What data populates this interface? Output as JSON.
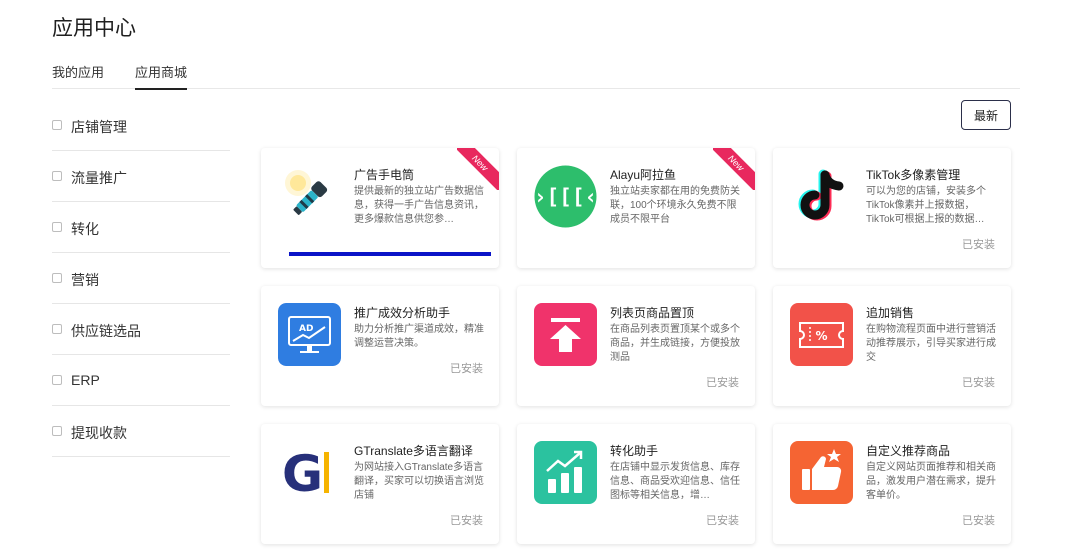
{
  "page": {
    "title": "应用中心"
  },
  "tabs": [
    {
      "label": "我的应用"
    },
    {
      "label": "应用商城"
    }
  ],
  "active_tab": "应用商城",
  "sidebar": {
    "categories": [
      {
        "label": "店铺管理"
      },
      {
        "label": "流量推广"
      },
      {
        "label": "转化"
      },
      {
        "label": "营销"
      },
      {
        "label": "供应链选品"
      },
      {
        "label": "ERP"
      },
      {
        "label": "提现收款"
      }
    ]
  },
  "sort": {
    "label": "最新"
  },
  "apps": [
    {
      "name": "广告手电筒",
      "desc": "提供最新的独立站广告数据信息，获得一手广告信息资讯，更多爆款信息供您参…",
      "status": "",
      "badge": "New",
      "progress": 1.0,
      "icon": "flashlight-icon",
      "icon_color": "#ffffff"
    },
    {
      "name": "Alayu阿拉鱼",
      "desc": "独立站卖家都在用的免费防关联，100个环境永久免费不限成员不限平台",
      "status": "",
      "badge": "New",
      "icon": "alayu-icon",
      "icon_color": "#2dbe6c"
    },
    {
      "name": "TikTok多像素管理",
      "desc": "可以为您的店铺，安装多个TikTok像素并上报数据，TikTok可根据上报的数据…",
      "status": "已安装",
      "icon": "tiktok-icon",
      "icon_color": "#ffffff"
    },
    {
      "name": "推广成效分析助手",
      "desc": "助力分析推广渠道成效，精准调整运营决策。",
      "status": "已安装",
      "icon": "ad-analysis-icon",
      "icon_color": "#2f7de1"
    },
    {
      "name": "列表页商品置顶",
      "desc": "在商品列表页置顶某个或多个商品，并生成链接，方便投放测品",
      "status": "已安装",
      "icon": "pin-top-icon",
      "icon_color": "#f0336b"
    },
    {
      "name": "追加销售",
      "desc": "在购物流程页面中进行营销活动推荐展示，引导买家进行成交",
      "status": "已安装",
      "icon": "coupon-icon",
      "icon_color": "#f25249"
    },
    {
      "name": "GTranslate多语言翻译",
      "desc": "为网站接入GTranslate多语言翻译，买家可以切换语言浏览店铺",
      "status": "已安装",
      "icon": "gtranslate-icon",
      "icon_color": "#ffffff"
    },
    {
      "name": "转化助手",
      "desc": "在店铺中显示发货信息、库存信息、商品受欢迎信息、信任图标等相关信息，增…",
      "status": "已安装",
      "icon": "conversion-chart-icon",
      "icon_color": "#2bc29f"
    },
    {
      "name": "自定义推荐商品",
      "desc": "自定义网站页面推荐和相关商品，激发用户潜在需求，提升客单价。",
      "status": "已安装",
      "icon": "thumbs-up-icon",
      "icon_color": "#f56433"
    }
  ]
}
